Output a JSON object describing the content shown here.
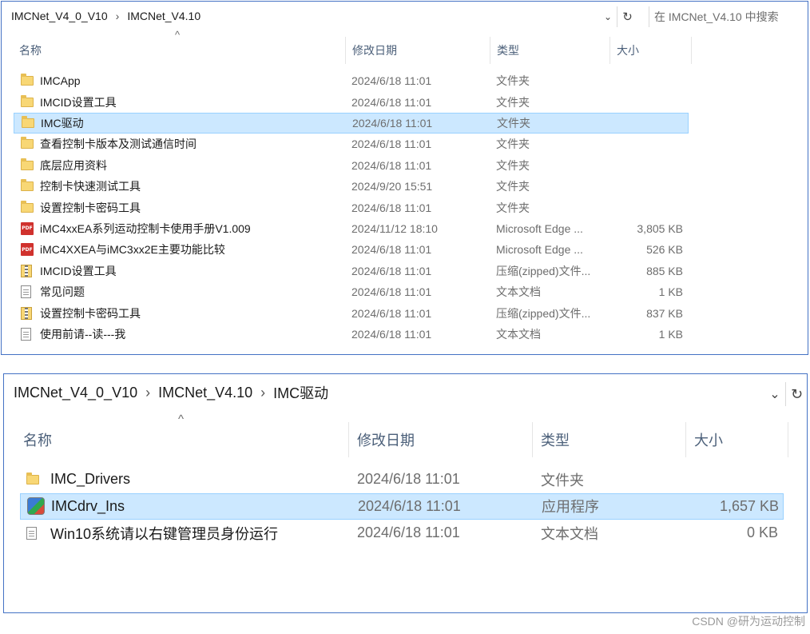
{
  "window1": {
    "breadcrumb": [
      "IMCNet_V4_0_V10",
      "IMCNet_V4.10"
    ],
    "search_placeholder": "在 IMCNet_V4.10 中搜索",
    "columns": {
      "name": "名称",
      "date": "修改日期",
      "type": "类型",
      "size": "大小"
    },
    "files": [
      {
        "icon": "folder-icon",
        "name": "IMCApp",
        "date": "2024/6/18 11:01",
        "type": "文件夹",
        "size": ""
      },
      {
        "icon": "folder-icon",
        "name": "IMCID设置工具",
        "date": "2024/6/18 11:01",
        "type": "文件夹",
        "size": ""
      },
      {
        "icon": "folder-icon",
        "name": "IMC驱动",
        "date": "2024/6/18 11:01",
        "type": "文件夹",
        "size": "",
        "selected": true
      },
      {
        "icon": "folder-icon",
        "name": "查看控制卡版本及测试通信时间",
        "date": "2024/6/18 11:01",
        "type": "文件夹",
        "size": ""
      },
      {
        "icon": "folder-icon",
        "name": "底层应用资料",
        "date": "2024/6/18 11:01",
        "type": "文件夹",
        "size": ""
      },
      {
        "icon": "folder-icon",
        "name": "控制卡快速测试工具",
        "date": "2024/9/20 15:51",
        "type": "文件夹",
        "size": ""
      },
      {
        "icon": "folder-icon",
        "name": "设置控制卡密码工具",
        "date": "2024/6/18 11:01",
        "type": "文件夹",
        "size": ""
      },
      {
        "icon": "pdf-icon",
        "name": "iMC4xxEA系列运动控制卡使用手册V1.009",
        "date": "2024/11/12 18:10",
        "type": "Microsoft Edge ...",
        "size": "3,805 KB"
      },
      {
        "icon": "pdf-icon",
        "name": "iMC4XXEA与iMC3xx2E主要功能比较",
        "date": "2024/6/18 11:01",
        "type": "Microsoft Edge ...",
        "size": "526 KB"
      },
      {
        "icon": "zip-icon",
        "name": "IMCID设置工具",
        "date": "2024/6/18 11:01",
        "type": "压缩(zipped)文件...",
        "size": "885 KB"
      },
      {
        "icon": "text-file-icon",
        "name": "常见问题",
        "date": "2024/6/18 11:01",
        "type": "文本文档",
        "size": "1 KB"
      },
      {
        "icon": "zip-icon",
        "name": "设置控制卡密码工具",
        "date": "2024/6/18 11:01",
        "type": "压缩(zipped)文件...",
        "size": "837 KB"
      },
      {
        "icon": "text-file-icon",
        "name": "使用前请--读---我",
        "date": "2024/6/18 11:01",
        "type": "文本文档",
        "size": "1 KB"
      }
    ]
  },
  "window2": {
    "breadcrumb": [
      "IMCNet_V4_0_V10",
      "IMCNet_V4.10",
      "IMC驱动"
    ],
    "columns": {
      "name": "名称",
      "date": "修改日期",
      "type": "类型",
      "size": "大小"
    },
    "files": [
      {
        "icon": "folder-icon",
        "name": "IMC_Drivers",
        "date": "2024/6/18 11:01",
        "type": "文件夹",
        "size": ""
      },
      {
        "icon": "installer-icon",
        "name": "IMCdrv_Ins",
        "date": "2024/6/18 11:01",
        "type": "应用程序",
        "size": "1,657 KB",
        "selected": true
      },
      {
        "icon": "text-file-icon",
        "name": "Win10系统请以右键管理员身份运行",
        "date": "2024/6/18 11:01",
        "type": "文本文档",
        "size": "0 KB"
      }
    ]
  },
  "watermark": "CSDN @研为运动控制"
}
